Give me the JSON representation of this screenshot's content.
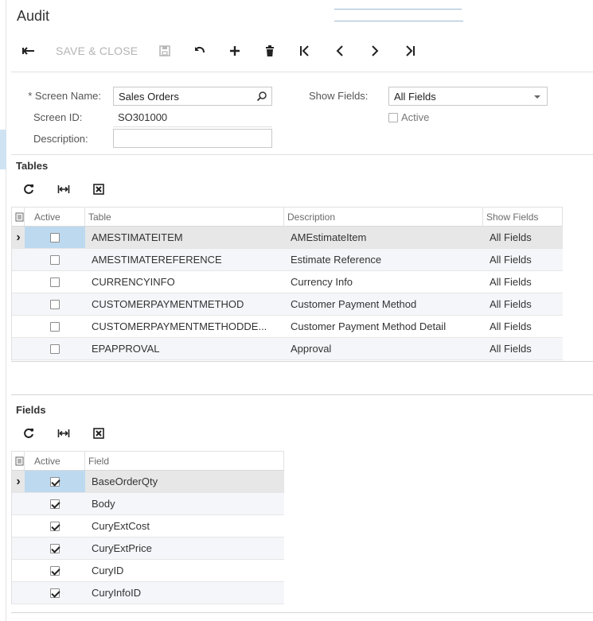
{
  "title": "Audit",
  "toolbar": {
    "save_close_label": "SAVE & CLOSE"
  },
  "form": {
    "screen_name_label": "* Screen Name:",
    "screen_name_value": "Sales Orders",
    "screen_id_label": "Screen ID:",
    "screen_id_value": "SO301000",
    "description_label": "Description:",
    "description_value": "",
    "show_fields_label": "Show Fields:",
    "show_fields_value": "All Fields",
    "active_label": "Active"
  },
  "tables": {
    "title": "Tables",
    "headers": {
      "active": "Active",
      "table": "Table",
      "description": "Description",
      "show_fields": "Show Fields"
    },
    "rows": [
      {
        "active": false,
        "table": "AMESTIMATEITEM",
        "description": "AMEstimateItem",
        "show_fields": "All Fields"
      },
      {
        "active": false,
        "table": "AMESTIMATEREFERENCE",
        "description": "Estimate Reference",
        "show_fields": "All Fields"
      },
      {
        "active": false,
        "table": "CURRENCYINFO",
        "description": "Currency Info",
        "show_fields": "All Fields"
      },
      {
        "active": false,
        "table": "CUSTOMERPAYMENTMETHOD",
        "description": "Customer Payment Method",
        "show_fields": "All Fields"
      },
      {
        "active": false,
        "table": "CUSTOMERPAYMENTMETHODDE...",
        "description": "Customer Payment Method Detail",
        "show_fields": "All Fields"
      },
      {
        "active": false,
        "table": "EPAPPROVAL",
        "description": "Approval",
        "show_fields": "All Fields"
      }
    ]
  },
  "fields": {
    "title": "Fields",
    "headers": {
      "active": "Active",
      "field": "Field"
    },
    "rows": [
      {
        "active": true,
        "field": "BaseOrderQty"
      },
      {
        "active": true,
        "field": "Body"
      },
      {
        "active": true,
        "field": "CuryExtCost"
      },
      {
        "active": true,
        "field": "CuryExtPrice"
      },
      {
        "active": true,
        "field": "CuryID"
      },
      {
        "active": true,
        "field": "CuryInfoID"
      }
    ]
  }
}
